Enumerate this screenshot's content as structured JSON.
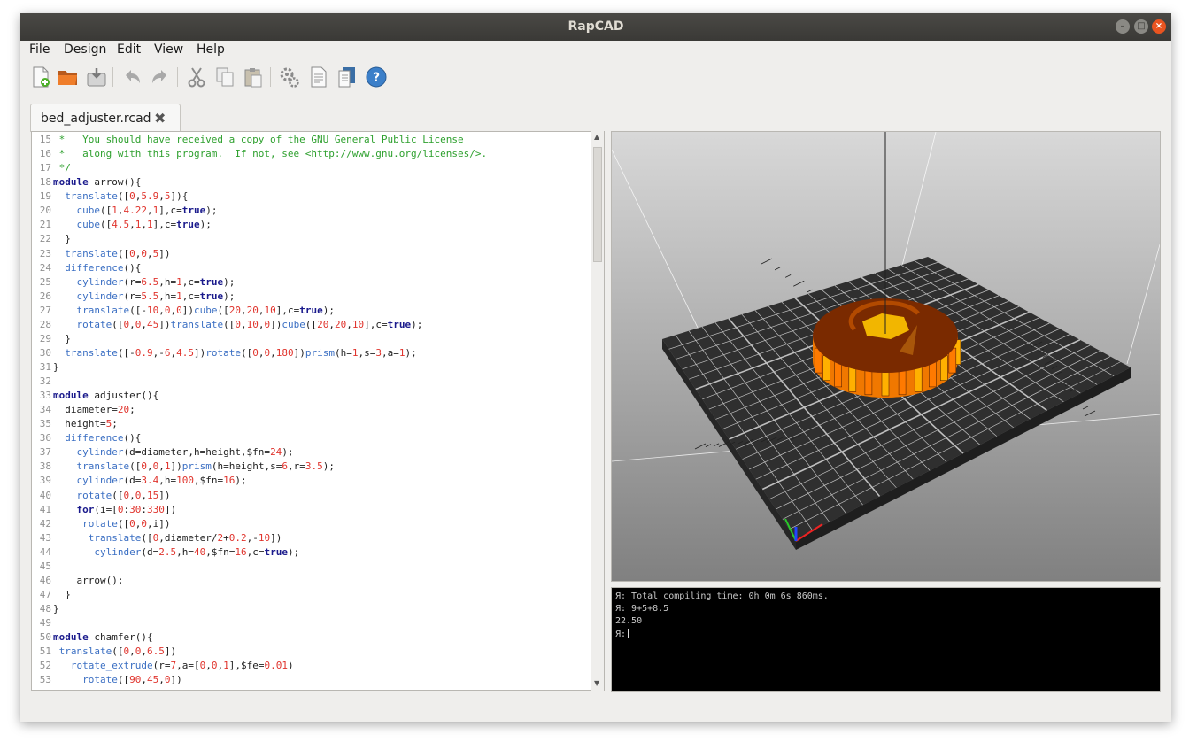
{
  "window": {
    "title": "RapCAD"
  },
  "menu": [
    "File",
    "Design",
    "Edit",
    "View",
    "Help"
  ],
  "toolbar_icons": [
    "new-file-icon",
    "open-folder-icon",
    "save-icon",
    "undo-icon",
    "redo-icon",
    "cut-icon",
    "copy-icon",
    "paste-icon",
    "compile-gears-icon",
    "generate-document-icon",
    "export-document-icon",
    "help-icon"
  ],
  "tab": {
    "label": "bed_adjuster.rcad",
    "close_glyph": "✖"
  },
  "code_lines": [
    {
      "n": "15",
      "t": " *   You should have received a copy of the GNU General Public License"
    },
    {
      "n": "16",
      "t": " *   along with this program.  If not, see <http://www.gnu.org/licenses/>."
    },
    {
      "n": "17",
      "t": " */"
    },
    {
      "n": "18",
      "t": "module arrow(){"
    },
    {
      "n": "19",
      "t": "  translate([0,5.9,5]){"
    },
    {
      "n": "20",
      "t": "    cube([1,4.22,1],c=true);"
    },
    {
      "n": "21",
      "t": "    cube([4.5,1,1],c=true);"
    },
    {
      "n": "22",
      "t": "  }"
    },
    {
      "n": "23",
      "t": "  translate([0,0,5])"
    },
    {
      "n": "24",
      "t": "  difference(){"
    },
    {
      "n": "25",
      "t": "    cylinder(r=6.5,h=1,c=true);"
    },
    {
      "n": "26",
      "t": "    cylinder(r=5.5,h=1,c=true);"
    },
    {
      "n": "27",
      "t": "    translate([-10,0,0])cube([20,20,10],c=true);"
    },
    {
      "n": "28",
      "t": "    rotate([0,0,45])translate([0,10,0])cube([20,20,10],c=true);"
    },
    {
      "n": "29",
      "t": "  }"
    },
    {
      "n": "30",
      "t": "  translate([-0.9,-6,4.5])rotate([0,0,180])prism(h=1,s=3,a=1);"
    },
    {
      "n": "31",
      "t": "}"
    },
    {
      "n": "32",
      "t": ""
    },
    {
      "n": "33",
      "t": "module adjuster(){"
    },
    {
      "n": "34",
      "t": "  diameter=20;"
    },
    {
      "n": "35",
      "t": "  height=5;"
    },
    {
      "n": "36",
      "t": "  difference(){"
    },
    {
      "n": "37",
      "t": "    cylinder(d=diameter,h=height,$fn=24);"
    },
    {
      "n": "38",
      "t": "    translate([0,0,1])prism(h=height,s=6,r=3.5);"
    },
    {
      "n": "39",
      "t": "    cylinder(d=3.4,h=100,$fn=16);"
    },
    {
      "n": "40",
      "t": "    rotate([0,0,15])"
    },
    {
      "n": "41",
      "t": "    for(i=[0:30:330])"
    },
    {
      "n": "42",
      "t": "     rotate([0,0,i])"
    },
    {
      "n": "43",
      "t": "      translate([0,diameter/2+0.2,-10])"
    },
    {
      "n": "44",
      "t": "       cylinder(d=2.5,h=40,$fn=16,c=true);"
    },
    {
      "n": "45",
      "t": ""
    },
    {
      "n": "46",
      "t": "    arrow();"
    },
    {
      "n": "47",
      "t": "  }"
    },
    {
      "n": "48",
      "t": "}"
    },
    {
      "n": "49",
      "t": ""
    },
    {
      "n": "50",
      "t": "module chamfer(){"
    },
    {
      "n": "51",
      "t": " translate([0,0,6.5])"
    },
    {
      "n": "52",
      "t": "   rotate_extrude(r=7,a=[0,0,1],$fe=0.01)"
    },
    {
      "n": "53",
      "t": "     rotate([90,45,0])"
    }
  ],
  "console_lines": [
    "Я: Total compiling time: 0h 0m 6s 860ms.",
    "Я: 9+5+8.5",
    "22.50",
    "Я:"
  ],
  "colors": {
    "titlebar": "#3c3b37",
    "close_button": "#e95420",
    "viewport_bg": "#8a8a8a",
    "platform": "#2f2f2f",
    "model_top": "#7a2a00",
    "model_side": "#f08000"
  }
}
